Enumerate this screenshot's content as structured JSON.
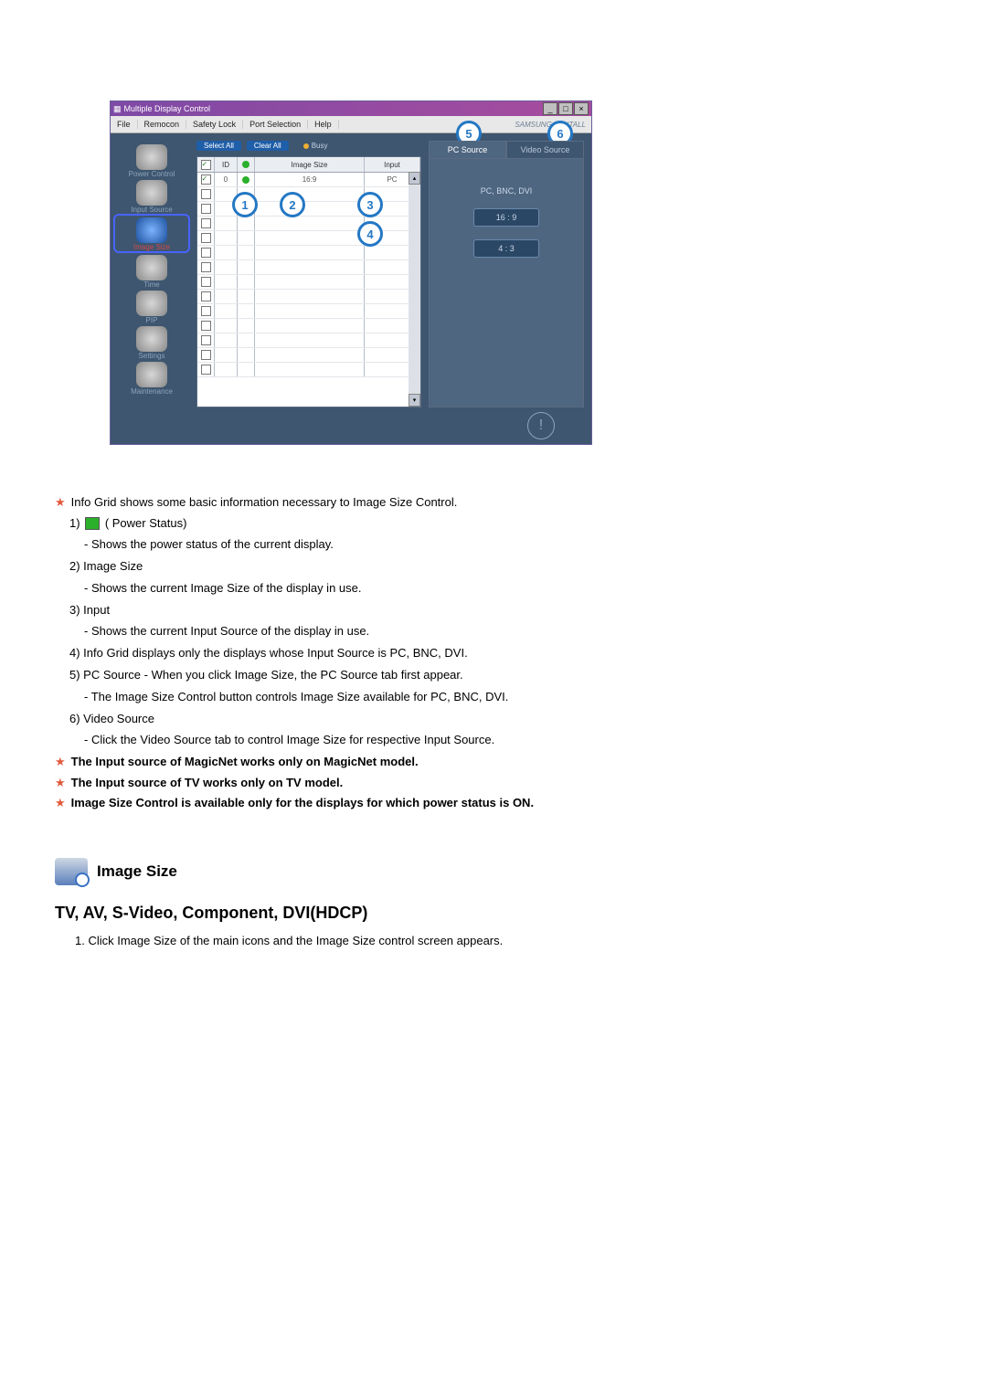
{
  "app": {
    "title": "Multiple Display Control",
    "menus": [
      "File",
      "Remocon",
      "Safety Lock",
      "Port Selection",
      "Help"
    ],
    "brand": "SAMSUNG DIGITALL"
  },
  "sidebar": {
    "items": [
      {
        "label": "Power Control"
      },
      {
        "label": "Input Source"
      },
      {
        "label": "Image Size",
        "selected": true
      },
      {
        "label": "Time"
      },
      {
        "label": "PIP"
      },
      {
        "label": "Settings"
      },
      {
        "label": "Maintenance"
      }
    ]
  },
  "topbar": {
    "select_all": "Select All",
    "clear_all": "Clear All",
    "busy": "Busy"
  },
  "grid": {
    "headers": {
      "chk": "☑",
      "id": "ID",
      "pw": "",
      "size": "Image Size",
      "input": "Input"
    },
    "row0": {
      "id": "0",
      "size": "16:9",
      "input": "PC"
    }
  },
  "callouts": {
    "c1": "1",
    "c2": "2",
    "c3": "3",
    "c4": "4",
    "c5": "5",
    "c6": "6"
  },
  "tabs": {
    "pc": "PC Source",
    "video": "Video Source"
  },
  "panel": {
    "label": "PC, BNC, DVI",
    "b1": "16 : 9",
    "b2": "4 : 3"
  },
  "notes": {
    "n0": "Info Grid shows some basic information necessary to Image Size Control.",
    "l1": "1)",
    "l1b": "( Power Status)",
    "l1s": "- Shows the power status of the current display.",
    "l2": "2)  Image Size",
    "l2s": "- Shows the current Image Size of the display in use.",
    "l3": "3)  Input",
    "l3s": "- Shows the current Input Source of the display in use.",
    "l4": "4)  Info Grid displays only the displays whose Input Source is PC, BNC, DVI.",
    "l5": "5)  PC Source - When you click Image Size, the PC Source tab first appear.",
    "l5s": "- The Image Size Control button controls Image Size available for PC, BNC, DVI.",
    "l6": "6)  Video Source",
    "l6s": "- Click the Video Source tab to control Image Size for respective Input Source.",
    "b1": "The Input source of MagicNet works only on MagicNet model.",
    "b2": "The Input source of TV works only on TV model.",
    "b3": "Image Size Control is available only for the displays for which power status is ON."
  },
  "section": {
    "title": "Image Size",
    "h2": "TV, AV, S-Video, Component, DVI(HDCP)",
    "ol1": "1.  Click Image Size of the main icons and the Image Size control screen appears."
  }
}
